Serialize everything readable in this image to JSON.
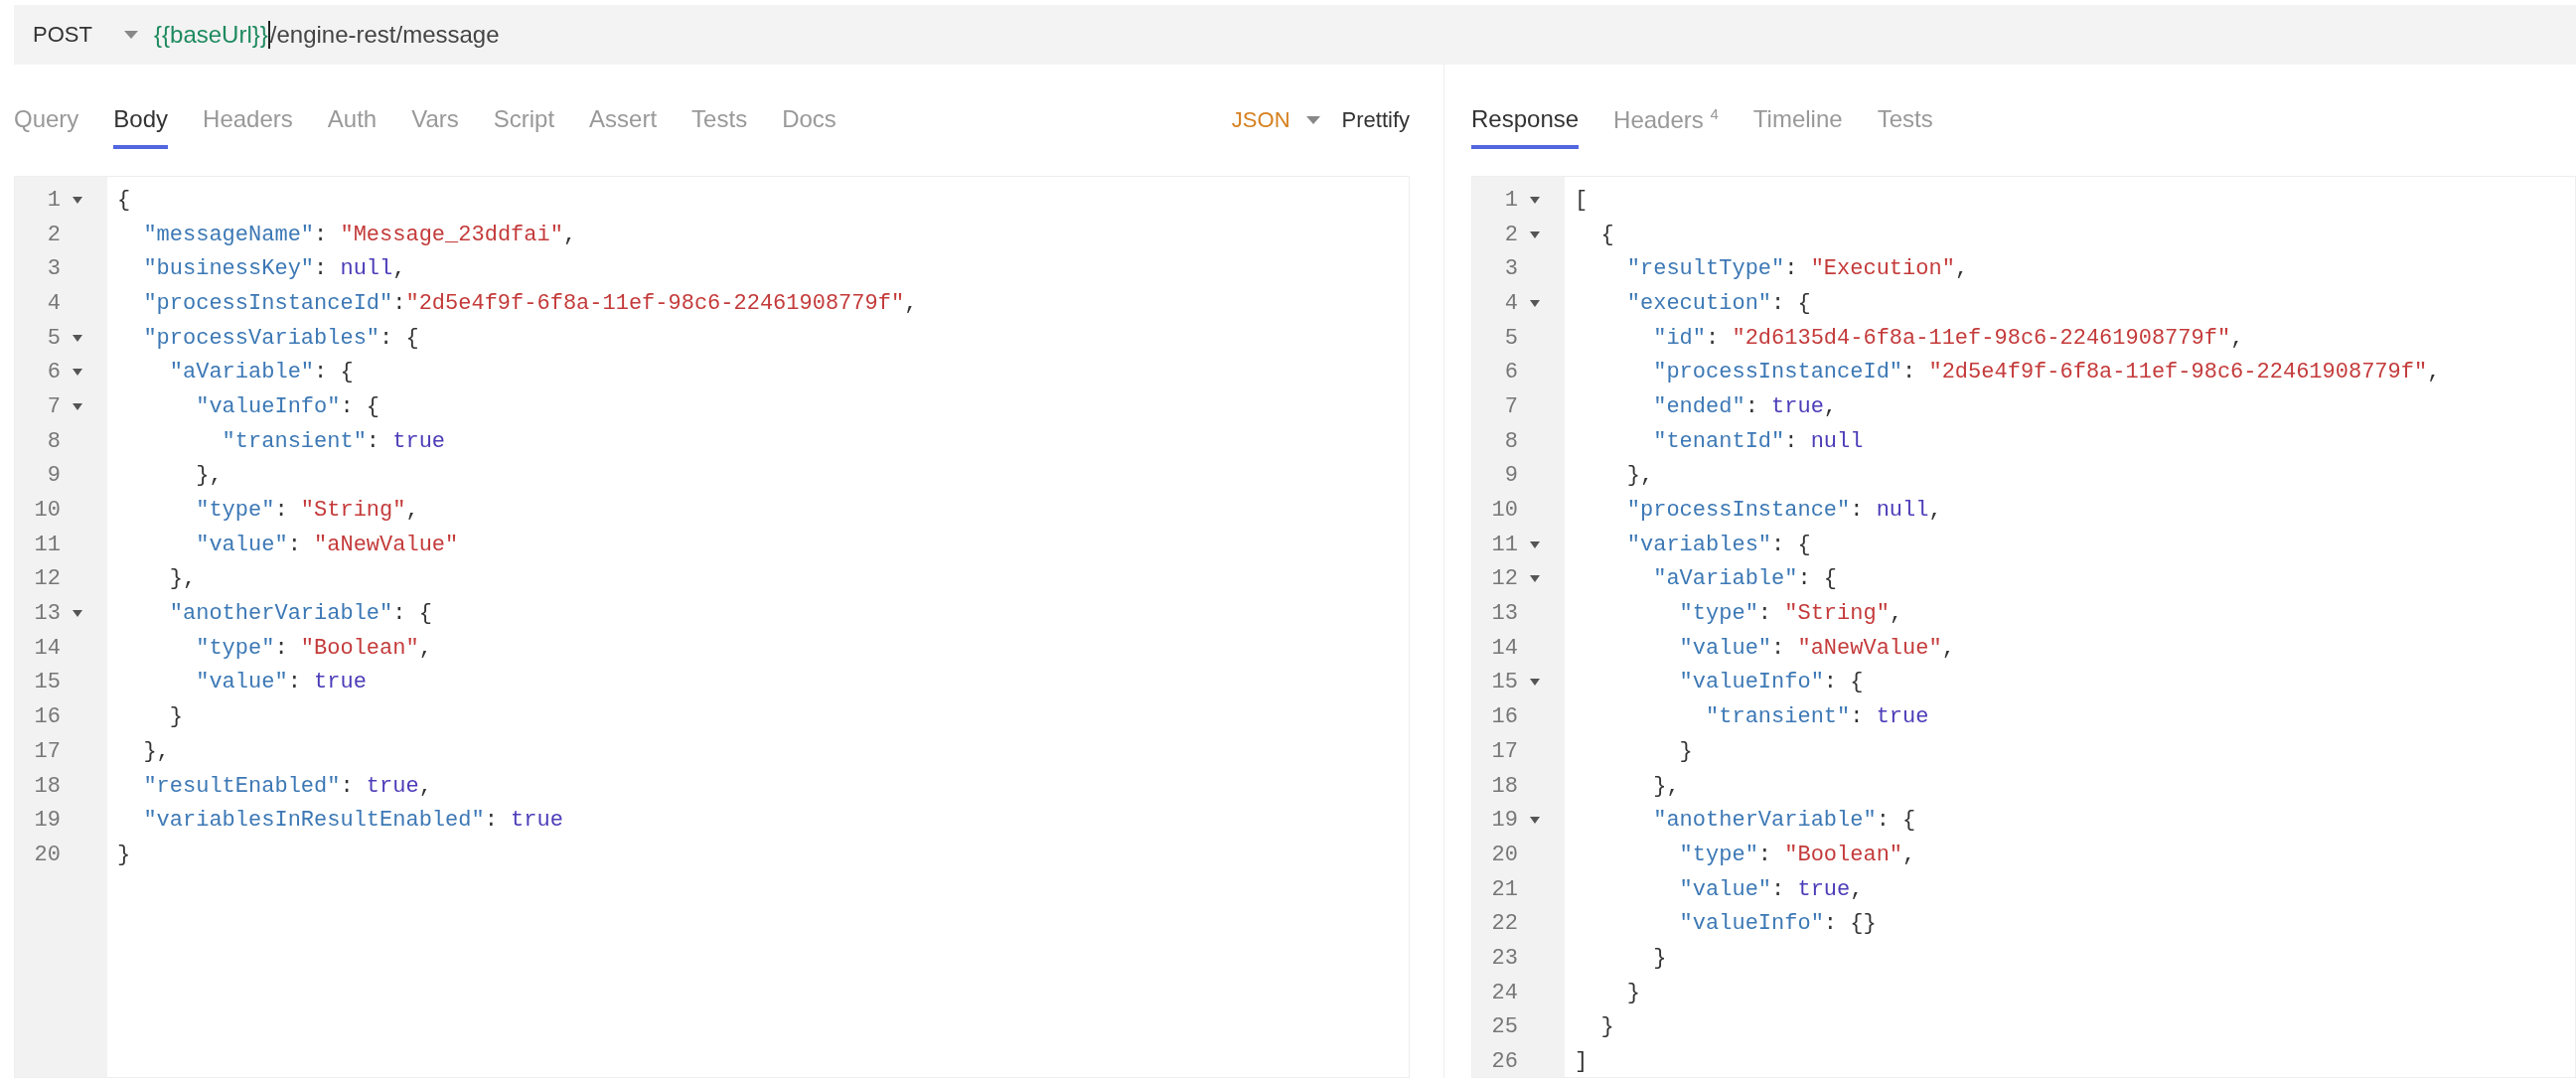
{
  "request_bar": {
    "method": "POST",
    "url": [
      {
        "kind": "variable",
        "text": "{{baseUrl}}"
      },
      {
        "kind": "path",
        "text": "/engine-rest/message"
      }
    ]
  },
  "request_pane": {
    "tabs": [
      {
        "label": "Query",
        "selected": false
      },
      {
        "label": "Body",
        "selected": true
      },
      {
        "label": "Headers",
        "selected": false
      },
      {
        "label": "Auth",
        "selected": false
      },
      {
        "label": "Vars",
        "selected": false
      },
      {
        "label": "Script",
        "selected": false
      },
      {
        "label": "Assert",
        "selected": false
      },
      {
        "label": "Tests",
        "selected": false
      },
      {
        "label": "Docs",
        "selected": false
      }
    ],
    "body_mode": "JSON",
    "prettify": "Prettify",
    "editor": [
      {
        "n": "1",
        "fold": true,
        "tokens": [
          {
            "kind": "punct",
            "text": "{"
          }
        ]
      },
      {
        "n": "2",
        "fold": false,
        "tokens": [
          {
            "kind": "key",
            "text": "  \"messageName\""
          },
          {
            "kind": "punct",
            "text": ": "
          },
          {
            "kind": "string",
            "text": "\"Message_23ddfai\""
          },
          {
            "kind": "punct",
            "text": ","
          }
        ]
      },
      {
        "n": "3",
        "fold": false,
        "tokens": [
          {
            "kind": "key",
            "text": "  \"businessKey\""
          },
          {
            "kind": "punct",
            "text": ": "
          },
          {
            "kind": "literal",
            "text": "null"
          },
          {
            "kind": "punct",
            "text": ","
          }
        ]
      },
      {
        "n": "4",
        "fold": false,
        "tokens": [
          {
            "kind": "key",
            "text": "  \"processInstanceId\""
          },
          {
            "kind": "punct",
            "text": ":"
          },
          {
            "kind": "string",
            "text": "\"2d5e4f9f-6f8a-11ef-98c6-22461908779f\""
          },
          {
            "kind": "punct",
            "text": ","
          }
        ]
      },
      {
        "n": "5",
        "fold": true,
        "tokens": [
          {
            "kind": "key",
            "text": "  \"processVariables\""
          },
          {
            "kind": "punct",
            "text": ": {"
          }
        ]
      },
      {
        "n": "6",
        "fold": true,
        "tokens": [
          {
            "kind": "key",
            "text": "    \"aVariable\""
          },
          {
            "kind": "punct",
            "text": ": {"
          }
        ]
      },
      {
        "n": "7",
        "fold": true,
        "tokens": [
          {
            "kind": "key",
            "text": "      \"valueInfo\""
          },
          {
            "kind": "punct",
            "text": ": {"
          }
        ]
      },
      {
        "n": "8",
        "fold": false,
        "tokens": [
          {
            "kind": "key",
            "text": "        \"transient\""
          },
          {
            "kind": "punct",
            "text": ": "
          },
          {
            "kind": "literal",
            "text": "true"
          }
        ]
      },
      {
        "n": "9",
        "fold": false,
        "tokens": [
          {
            "kind": "punct",
            "text": "      },"
          }
        ]
      },
      {
        "n": "10",
        "fold": false,
        "tokens": [
          {
            "kind": "key",
            "text": "      \"type\""
          },
          {
            "kind": "punct",
            "text": ": "
          },
          {
            "kind": "string",
            "text": "\"String\""
          },
          {
            "kind": "punct",
            "text": ","
          }
        ]
      },
      {
        "n": "11",
        "fold": false,
        "tokens": [
          {
            "kind": "key",
            "text": "      \"value\""
          },
          {
            "kind": "punct",
            "text": ": "
          },
          {
            "kind": "string",
            "text": "\"aNewValue\""
          }
        ]
      },
      {
        "n": "12",
        "fold": false,
        "tokens": [
          {
            "kind": "punct",
            "text": "    },"
          }
        ]
      },
      {
        "n": "13",
        "fold": true,
        "tokens": [
          {
            "kind": "key",
            "text": "    \"anotherVariable\""
          },
          {
            "kind": "punct",
            "text": ": {"
          }
        ]
      },
      {
        "n": "14",
        "fold": false,
        "tokens": [
          {
            "kind": "key",
            "text": "      \"type\""
          },
          {
            "kind": "punct",
            "text": ": "
          },
          {
            "kind": "string",
            "text": "\"Boolean\""
          },
          {
            "kind": "punct",
            "text": ","
          }
        ]
      },
      {
        "n": "15",
        "fold": false,
        "tokens": [
          {
            "kind": "key",
            "text": "      \"value\""
          },
          {
            "kind": "punct",
            "text": ": "
          },
          {
            "kind": "literal",
            "text": "true"
          }
        ]
      },
      {
        "n": "16",
        "fold": false,
        "tokens": [
          {
            "kind": "punct",
            "text": "    }"
          }
        ]
      },
      {
        "n": "17",
        "fold": false,
        "tokens": [
          {
            "kind": "punct",
            "text": "  },"
          }
        ]
      },
      {
        "n": "18",
        "fold": false,
        "tokens": [
          {
            "kind": "key",
            "text": "  \"resultEnabled\""
          },
          {
            "kind": "punct",
            "text": ": "
          },
          {
            "kind": "literal",
            "text": "true"
          },
          {
            "kind": "punct",
            "text": ","
          }
        ]
      },
      {
        "n": "19",
        "fold": false,
        "tokens": [
          {
            "kind": "key",
            "text": "  \"variablesInResultEnabled\""
          },
          {
            "kind": "punct",
            "text": ": "
          },
          {
            "kind": "literal",
            "text": "true"
          }
        ]
      },
      {
        "n": "20",
        "fold": false,
        "tokens": [
          {
            "kind": "punct",
            "text": "}"
          }
        ]
      }
    ]
  },
  "response_pane": {
    "tabs": [
      {
        "label": "Response",
        "selected": true
      },
      {
        "label": "Headers $^{4}$",
        "selected": false
      },
      {
        "label": "Timeline",
        "selected": false
      },
      {
        "label": "Tests",
        "selected": false
      }
    ],
    "editor": [
      {
        "n": "1",
        "fold": true,
        "tokens": [
          {
            "kind": "punct",
            "text": "["
          }
        ]
      },
      {
        "n": "2",
        "fold": true,
        "tokens": [
          {
            "kind": "punct",
            "text": "  {"
          }
        ]
      },
      {
        "n": "3",
        "fold": false,
        "tokens": [
          {
            "kind": "key",
            "text": "    \"resultType\""
          },
          {
            "kind": "punct",
            "text": ": "
          },
          {
            "kind": "string",
            "text": "\"Execution\""
          },
          {
            "kind": "punct",
            "text": ","
          }
        ]
      },
      {
        "n": "4",
        "fold": true,
        "tokens": [
          {
            "kind": "key",
            "text": "    \"execution\""
          },
          {
            "kind": "punct",
            "text": ": {"
          }
        ]
      },
      {
        "n": "5",
        "fold": false,
        "tokens": [
          {
            "kind": "key",
            "text": "      \"id\""
          },
          {
            "kind": "punct",
            "text": ": "
          },
          {
            "kind": "string",
            "text": "\"2d6135d4-6f8a-11ef-98c6-22461908779f\""
          },
          {
            "kind": "punct",
            "text": ","
          }
        ]
      },
      {
        "n": "6",
        "fold": false,
        "tokens": [
          {
            "kind": "key",
            "text": "      \"processInstanceId\""
          },
          {
            "kind": "punct",
            "text": ": "
          },
          {
            "kind": "string",
            "text": "\"2d5e4f9f-6f8a-11ef-98c6-22461908779f\""
          },
          {
            "kind": "punct",
            "text": ","
          }
        ]
      },
      {
        "n": "7",
        "fold": false,
        "tokens": [
          {
            "kind": "key",
            "text": "      \"ended\""
          },
          {
            "kind": "punct",
            "text": ": "
          },
          {
            "kind": "literal",
            "text": "true"
          },
          {
            "kind": "punct",
            "text": ","
          }
        ]
      },
      {
        "n": "8",
        "fold": false,
        "tokens": [
          {
            "kind": "key",
            "text": "      \"tenantId\""
          },
          {
            "kind": "punct",
            "text": ": "
          },
          {
            "kind": "literal",
            "text": "null"
          }
        ]
      },
      {
        "n": "9",
        "fold": false,
        "tokens": [
          {
            "kind": "punct",
            "text": "    },"
          }
        ]
      },
      {
        "n": "10",
        "fold": false,
        "tokens": [
          {
            "kind": "key",
            "text": "    \"processInstance\""
          },
          {
            "kind": "punct",
            "text": ": "
          },
          {
            "kind": "literal",
            "text": "null"
          },
          {
            "kind": "punct",
            "text": ","
          }
        ]
      },
      {
        "n": "11",
        "fold": true,
        "tokens": [
          {
            "kind": "key",
            "text": "    \"variables\""
          },
          {
            "kind": "punct",
            "text": ": {"
          }
        ]
      },
      {
        "n": "12",
        "fold": true,
        "tokens": [
          {
            "kind": "key",
            "text": "      \"aVariable\""
          },
          {
            "kind": "punct",
            "text": ": {"
          }
        ]
      },
      {
        "n": "13",
        "fold": false,
        "tokens": [
          {
            "kind": "key",
            "text": "        \"type\""
          },
          {
            "kind": "punct",
            "text": ": "
          },
          {
            "kind": "string",
            "text": "\"String\""
          },
          {
            "kind": "punct",
            "text": ","
          }
        ]
      },
      {
        "n": "14",
        "fold": false,
        "tokens": [
          {
            "kind": "key",
            "text": "        \"value\""
          },
          {
            "kind": "punct",
            "text": ": "
          },
          {
            "kind": "string",
            "text": "\"aNewValue\""
          },
          {
            "kind": "punct",
            "text": ","
          }
        ]
      },
      {
        "n": "15",
        "fold": true,
        "tokens": [
          {
            "kind": "key",
            "text": "        \"valueInfo\""
          },
          {
            "kind": "punct",
            "text": ": {"
          }
        ]
      },
      {
        "n": "16",
        "fold": false,
        "tokens": [
          {
            "kind": "key",
            "text": "          \"transient\""
          },
          {
            "kind": "punct",
            "text": ": "
          },
          {
            "kind": "literal",
            "text": "true"
          }
        ]
      },
      {
        "n": "17",
        "fold": false,
        "tokens": [
          {
            "kind": "punct",
            "text": "        }"
          }
        ]
      },
      {
        "n": "18",
        "fold": false,
        "tokens": [
          {
            "kind": "punct",
            "text": "      },"
          }
        ]
      },
      {
        "n": "19",
        "fold": true,
        "tokens": [
          {
            "kind": "key",
            "text": "      \"anotherVariable\""
          },
          {
            "kind": "punct",
            "text": ": {"
          }
        ]
      },
      {
        "n": "20",
        "fold": false,
        "tokens": [
          {
            "kind": "key",
            "text": "        \"type\""
          },
          {
            "kind": "punct",
            "text": ": "
          },
          {
            "kind": "string",
            "text": "\"Boolean\""
          },
          {
            "kind": "punct",
            "text": ","
          }
        ]
      },
      {
        "n": "21",
        "fold": false,
        "tokens": [
          {
            "kind": "key",
            "text": "        \"value\""
          },
          {
            "kind": "punct",
            "text": ": "
          },
          {
            "kind": "literal",
            "text": "true"
          },
          {
            "kind": "punct",
            "text": ","
          }
        ]
      },
      {
        "n": "22",
        "fold": false,
        "tokens": [
          {
            "kind": "key",
            "text": "        \"valueInfo\""
          },
          {
            "kind": "punct",
            "text": ": {}"
          }
        ]
      },
      {
        "n": "23",
        "fold": false,
        "tokens": [
          {
            "kind": "punct",
            "text": "      }"
          }
        ]
      },
      {
        "n": "24",
        "fold": false,
        "tokens": [
          {
            "kind": "punct",
            "text": "    }"
          }
        ]
      },
      {
        "n": "25",
        "fold": false,
        "tokens": [
          {
            "kind": "punct",
            "text": "  }"
          }
        ]
      },
      {
        "n": "26",
        "fold": false,
        "tokens": [
          {
            "kind": "punct",
            "text": "]"
          }
        ]
      }
    ]
  }
}
